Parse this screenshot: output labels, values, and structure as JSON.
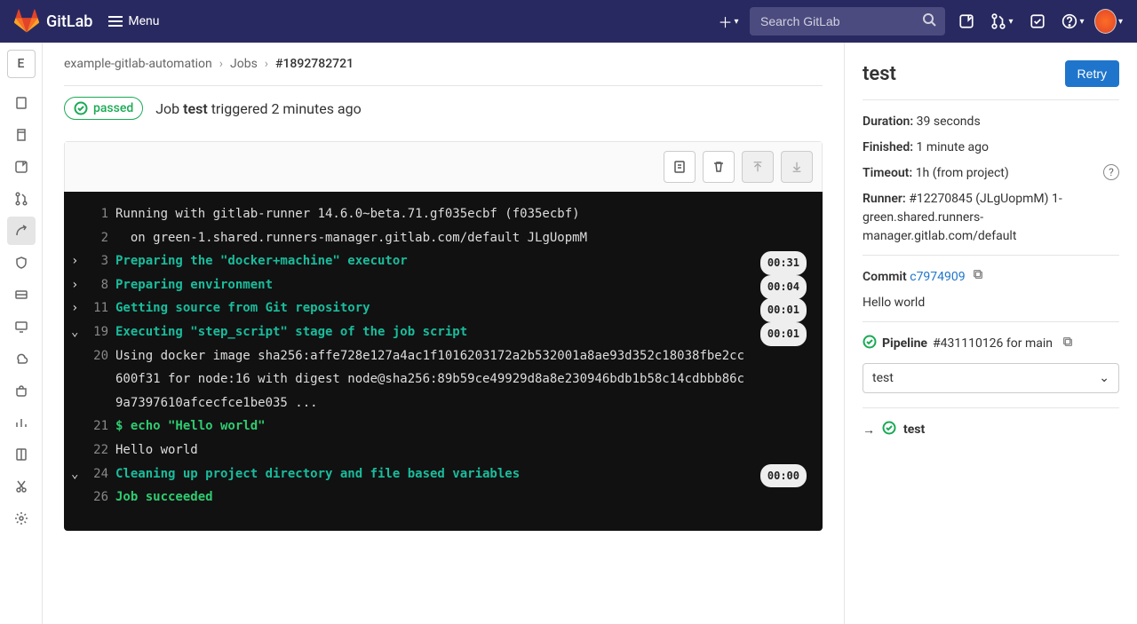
{
  "header": {
    "brand": "GitLab",
    "menu": "Menu",
    "search_placeholder": "Search GitLab"
  },
  "project_letter": "E",
  "breadcrumbs": {
    "project": "example-gitlab-automation",
    "section": "Jobs",
    "id": "#1892782721"
  },
  "status": {
    "badge": "passed",
    "prefix": "Job ",
    "name": "test",
    "suffix": " triggered 2 minutes ago"
  },
  "log_lines": [
    {
      "n": "1",
      "arrow": "",
      "cls": "",
      "t": "Running with gitlab-runner 14.6.0~beta.71.gf035ecbf (f035ecbf)",
      "time": ""
    },
    {
      "n": "2",
      "arrow": "",
      "cls": "",
      "t": "  on green-1.shared.runners-manager.gitlab.com/default JLgUopmM",
      "time": ""
    },
    {
      "n": "3",
      "arrow": "›",
      "cls": "cyan",
      "t": "Preparing the \"docker+machine\" executor",
      "time": "00:31"
    },
    {
      "n": "8",
      "arrow": "›",
      "cls": "cyan",
      "t": "Preparing environment",
      "time": "00:04"
    },
    {
      "n": "11",
      "arrow": "›",
      "cls": "cyan",
      "t": "Getting source from Git repository",
      "time": "00:01"
    },
    {
      "n": "19",
      "arrow": "⌄",
      "cls": "cyan",
      "t": "Executing \"step_script\" stage of the job script",
      "time": "00:01"
    },
    {
      "n": "20",
      "arrow": "",
      "cls": "",
      "t": "Using docker image sha256:affe728e127a4ac1f1016203172a2b532001a8ae93d352c18038fbe2cc600f31 for node:16 with digest node@sha256:89b59ce49929d8a8e230946bdb1b58c14cdbbb86c9a7397610afcecfce1be035 ...",
      "time": ""
    },
    {
      "n": "21",
      "arrow": "",
      "cls": "green",
      "t": "$ echo \"Hello world\"",
      "time": ""
    },
    {
      "n": "22",
      "arrow": "",
      "cls": "",
      "t": "Hello world",
      "time": ""
    },
    {
      "n": "24",
      "arrow": "⌄",
      "cls": "cyan",
      "t": "Cleaning up project directory and file based variables",
      "time": "00:00"
    },
    {
      "n": "26",
      "arrow": "",
      "cls": "green",
      "t": "Job succeeded",
      "time": ""
    }
  ],
  "side": {
    "title": "test",
    "retry": "Retry",
    "duration_label": "Duration:",
    "duration_value": "39 seconds",
    "finished_label": "Finished:",
    "finished_value": "1 minute ago",
    "timeout_label": "Timeout:",
    "timeout_value": "1h (from project)",
    "runner_label": "Runner:",
    "runner_value": "#12270845 (JLgUopmM) 1-green.shared.runners-manager.gitlab.com/default",
    "commit_label": "Commit",
    "commit_sha": "c7974909",
    "commit_msg": "Hello world",
    "pipeline_label": "Pipeline",
    "pipeline_text": "#431110126 for main",
    "stage_select": "test",
    "stage_item": "test"
  }
}
